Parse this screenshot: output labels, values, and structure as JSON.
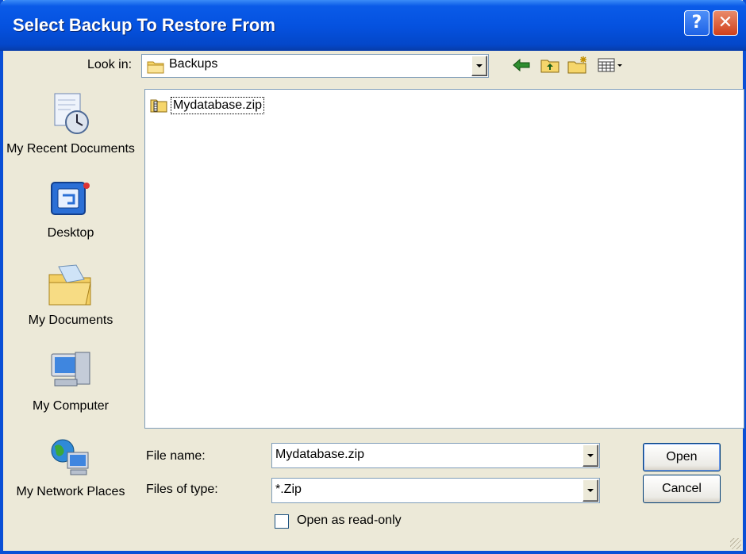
{
  "window": {
    "title": "Select Backup To Restore From",
    "help_label": "?",
    "close_label": "✕"
  },
  "look_in": {
    "label": "Look in:",
    "value": "Backups"
  },
  "places": [
    {
      "label": "My Recent Documents",
      "icon": "recent-documents-icon"
    },
    {
      "label": "Desktop",
      "icon": "desktop-icon"
    },
    {
      "label": "My Documents",
      "icon": "my-documents-icon"
    },
    {
      "label": "My Computer",
      "icon": "my-computer-icon"
    },
    {
      "label": "My Network Places",
      "icon": "network-places-icon"
    }
  ],
  "files": [
    {
      "name": "Mydatabase.zip",
      "icon": "zip-folder-icon"
    }
  ],
  "file_name": {
    "label": "File name:",
    "value": "Mydatabase.zip"
  },
  "file_type": {
    "label": "Files of type:",
    "value": "*.Zip"
  },
  "read_only": {
    "label": "Open as read-only",
    "checked": false
  },
  "buttons": {
    "open": "Open",
    "cancel": "Cancel"
  },
  "colors": {
    "titlebar": "#0552e0",
    "dialog_bg": "#ece9d8",
    "border_accent": "#7f9db9"
  }
}
